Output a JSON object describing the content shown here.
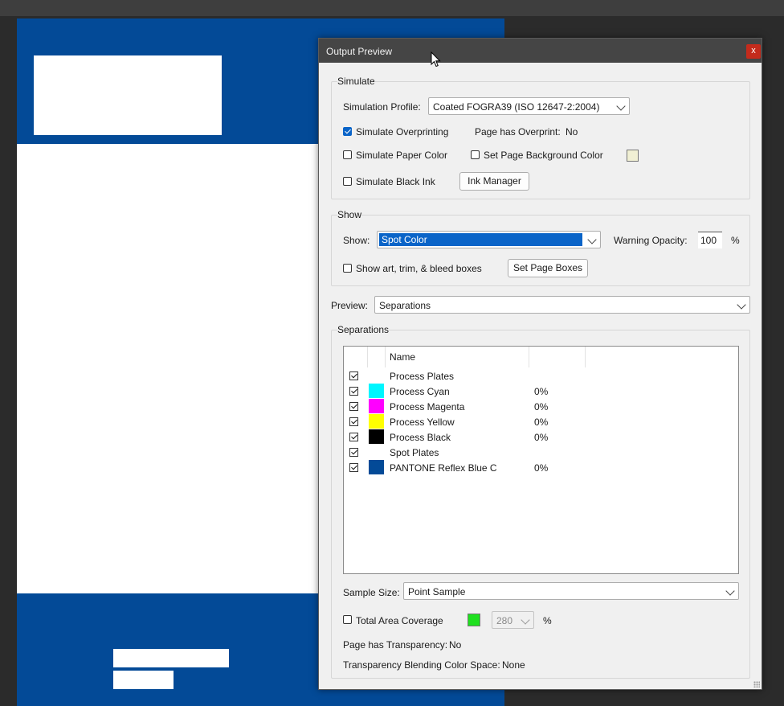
{
  "dialog": {
    "title": "Output Preview",
    "close_label": "x"
  },
  "simulate": {
    "group_label": "Simulate",
    "profile_label": "Simulation Profile:",
    "profile_value": "Coated FOGRA39 (ISO 12647-2:2004)",
    "overprinting_label": "Simulate Overprinting",
    "overprinting_checked": true,
    "has_overprint_label": "Page has Overprint:",
    "has_overprint_value": "No",
    "paper_color_label": "Simulate Paper Color",
    "bg_color_label": "Set Page Background Color",
    "bg_swatch_color": "#f1f0d4",
    "black_ink_label": "Simulate Black Ink",
    "ink_manager_label": "Ink Manager"
  },
  "show": {
    "group_label": "Show",
    "show_label": "Show:",
    "show_value": "Spot Color",
    "warning_opacity_label": "Warning Opacity:",
    "warning_opacity_value": "100",
    "percent": "%",
    "boxes_label": "Show art, trim, & bleed boxes",
    "set_page_boxes_label": "Set Page Boxes"
  },
  "preview": {
    "label": "Preview:",
    "value": "Separations"
  },
  "separations": {
    "group_label": "Separations",
    "name_header": "Name",
    "rows": [
      {
        "name": "Process Plates",
        "pct": "",
        "color": ""
      },
      {
        "name": "Process Cyan",
        "pct": "0%",
        "color": "#00f6ff"
      },
      {
        "name": "Process Magenta",
        "pct": "0%",
        "color": "#ff00ff"
      },
      {
        "name": "Process Yellow",
        "pct": "0%",
        "color": "#ffff00"
      },
      {
        "name": "Process Black",
        "pct": "0%",
        "color": "#000000"
      },
      {
        "name": "Spot Plates",
        "pct": "",
        "color": ""
      },
      {
        "name": "PANTONE Reflex Blue C",
        "pct": "0%",
        "color": "#034a97"
      }
    ]
  },
  "sample": {
    "label": "Sample Size:",
    "value": "Point Sample"
  },
  "coverage": {
    "label": "Total Area Coverage",
    "swatch_color": "#1fe01f",
    "value": "280",
    "percent": "%"
  },
  "transparency": {
    "has_label": "Page has Transparency:",
    "has_value": "No",
    "blend_label": "Transparency Blending Color Space:",
    "blend_value": "None"
  },
  "colors": {
    "page_blue": "#034a97",
    "accent": "#0a64c8"
  }
}
